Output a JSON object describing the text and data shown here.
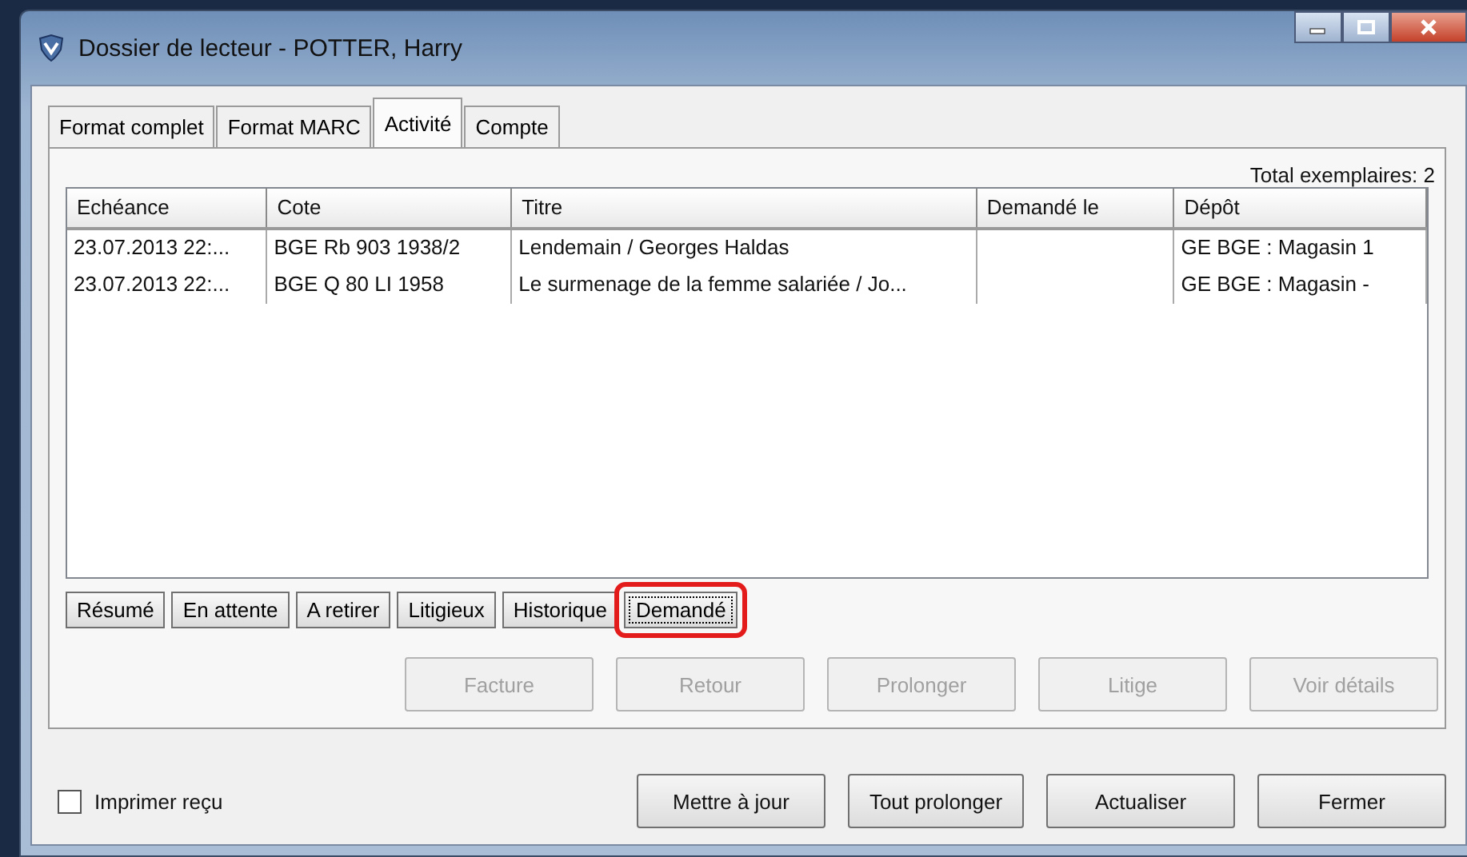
{
  "window": {
    "title": "Dossier de lecteur - POTTER, Harry"
  },
  "tabs": [
    {
      "label": "Format complet",
      "selected": false
    },
    {
      "label": "Format MARC",
      "selected": false
    },
    {
      "label": "Activité",
      "selected": true
    },
    {
      "label": "Compte",
      "selected": false
    }
  ],
  "total": "Total exemplaires: 2",
  "table": {
    "columns": [
      "Echéance",
      "Cote",
      "Titre",
      "Demandé le",
      "Dépôt"
    ],
    "rows": [
      [
        "23.07.2013 22:...",
        "BGE Rb 903 1938/2",
        "Lendemain / Georges Haldas",
        "",
        "GE BGE : Magasin 1"
      ],
      [
        "23.07.2013 22:...",
        "BGE Q 80 LI 1958",
        "Le surmenage de la femme salariée / Jo...",
        "",
        "GE BGE : Magasin -"
      ]
    ]
  },
  "subtabs": [
    {
      "label": "Résumé",
      "selected": false
    },
    {
      "label": "En attente",
      "selected": false
    },
    {
      "label": "A retirer",
      "selected": false
    },
    {
      "label": "Litigieux",
      "selected": false
    },
    {
      "label": "Historique",
      "selected": false
    },
    {
      "label": "Demandé",
      "selected": true,
      "highlighted": true
    }
  ],
  "actions": [
    {
      "label": "Facture",
      "disabled": true
    },
    {
      "label": "Retour",
      "disabled": true
    },
    {
      "label": "Prolonger",
      "disabled": true
    },
    {
      "label": "Litige",
      "disabled": true
    },
    {
      "label": "Voir détails",
      "disabled": true
    }
  ],
  "print_receipt": {
    "label": "Imprimer reçu",
    "checked": false
  },
  "buttons": [
    {
      "label": "Mettre à jour",
      "disabled": false
    },
    {
      "label": "Tout prolonger",
      "disabled": false
    },
    {
      "label": "Actualiser",
      "disabled": false
    },
    {
      "label": "Fermer",
      "disabled": false
    }
  ]
}
